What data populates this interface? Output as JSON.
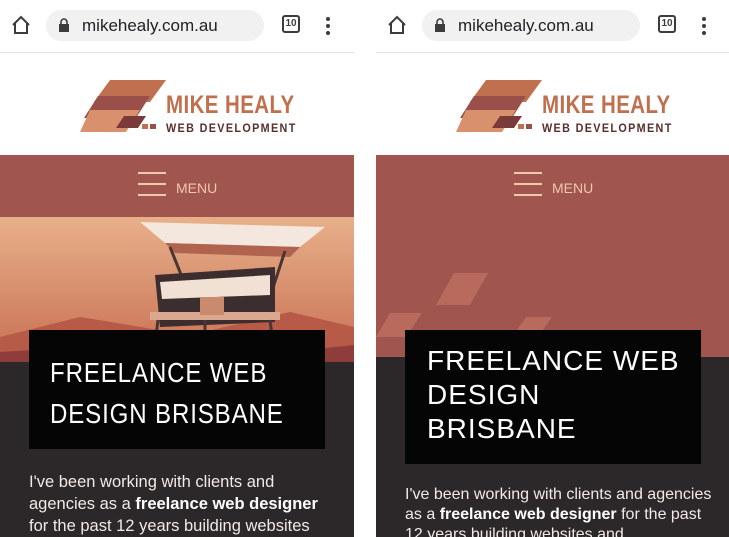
{
  "browser": {
    "url": "mikehealy.com.au",
    "tab_count": "10"
  },
  "logo": {
    "name": "MIKE HEALY",
    "tagline": "WEB DEVELOPMENT"
  },
  "nav": {
    "menu_label": "MENU"
  },
  "hero": {
    "title_line1": "FREELANCE WEB",
    "title_line2": "DESIGN BRISBANE",
    "right_title_line1": "FREELANCE WEB",
    "right_title_line2": "DESIGN",
    "right_title_line3": "BRISBANE"
  },
  "intro": {
    "part1": "I've been working with clients and agencies as a ",
    "bold": "freelance web designer",
    "part2": " for the past 12 years building websites",
    "right_part2": " for the past 12 years building websites and"
  },
  "colors": {
    "brand_orange": "#c0704f",
    "nav_red": "#a0554f",
    "dark": "#2c2728"
  }
}
